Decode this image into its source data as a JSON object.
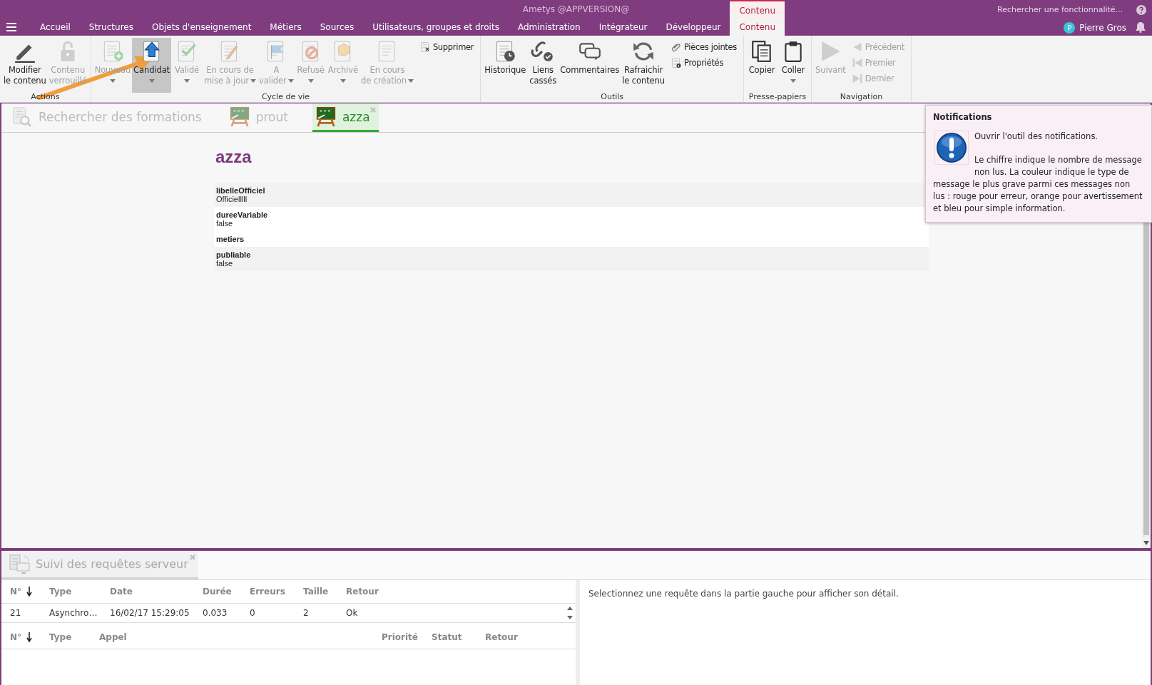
{
  "window": {
    "title": "Ametys @APPVERSION@"
  },
  "menu": {
    "contextual_group": "Contenu",
    "tabs": [
      {
        "label": "Accueil",
        "selected": false,
        "kind": "normal"
      },
      {
        "label": "Structures",
        "selected": false,
        "kind": "normal"
      },
      {
        "label": "Objets d'enseignement",
        "selected": false,
        "kind": "normal"
      },
      {
        "label": "Métiers",
        "selected": false,
        "kind": "normal"
      },
      {
        "label": "Sources",
        "selected": false,
        "kind": "normal"
      },
      {
        "label": "Utilisateurs, groupes et droits",
        "selected": false,
        "kind": "normal"
      },
      {
        "label": "Administration",
        "selected": false,
        "kind": "normal"
      },
      {
        "label": "Intégrateur",
        "selected": false,
        "kind": "normal"
      },
      {
        "label": "Développeur",
        "selected": false,
        "kind": "normal"
      },
      {
        "label": "Contenu",
        "selected": true,
        "kind": "contextual"
      }
    ]
  },
  "search": {
    "placeholder": "Rechercher une fonctionnalité..."
  },
  "user": {
    "initial": "P",
    "name": "Pierre Gros"
  },
  "ribbon": {
    "annotation": {
      "kind": "arrow"
    },
    "groups": [
      {
        "title": "Actions",
        "large": [
          {
            "label": "Modifier\nle contenu",
            "disabled": false,
            "selected": false
          },
          {
            "label": "Contenu\nverrouillé",
            "disabled": true,
            "selected": false
          }
        ]
      },
      {
        "title": "Cycle de vie",
        "large": [
          {
            "label": "Nouveau",
            "disabled": true,
            "selected": false,
            "menu": true,
            "caret_inline": false
          },
          {
            "label": "Candidat",
            "disabled": false,
            "selected": true,
            "menu": true,
            "caret_inline": false
          },
          {
            "label": "Validé",
            "disabled": true,
            "selected": false,
            "menu": true,
            "caret_inline": false
          },
          {
            "label": "En cours de\nmise à jour",
            "disabled": true,
            "selected": false,
            "menu": true,
            "caret_inline": true
          },
          {
            "label": "A\nvalider",
            "disabled": true,
            "selected": false,
            "menu": true,
            "caret_inline": true
          },
          {
            "label": "Refusé",
            "disabled": true,
            "selected": false,
            "menu": true,
            "caret_inline": false
          },
          {
            "label": "Archivé",
            "disabled": true,
            "selected": false,
            "menu": true,
            "caret_inline": false
          },
          {
            "label": "En cours\nde création",
            "disabled": true,
            "selected": false,
            "menu": true,
            "caret_inline": true
          }
        ],
        "small": [
          {
            "label": "Supprimer",
            "disabled": false
          }
        ]
      },
      {
        "title": "Outils",
        "large": [
          {
            "label": "Historique",
            "disabled": false,
            "selected": false
          },
          {
            "label": "Liens\ncassés",
            "disabled": false,
            "selected": false
          },
          {
            "label": "Commentaires",
            "disabled": false,
            "selected": false
          },
          {
            "label": "Rafraichir\nle contenu",
            "disabled": false,
            "selected": false
          }
        ],
        "small": [
          {
            "label": "Pièces jointes",
            "disabled": false
          },
          {
            "label": "Propriétés",
            "disabled": false
          }
        ]
      },
      {
        "title": "Presse-papiers",
        "large": [
          {
            "label": "Copier",
            "disabled": false,
            "selected": false
          },
          {
            "label": "Coller",
            "disabled": false,
            "selected": false,
            "menu": true,
            "caret_inline": false
          }
        ]
      },
      {
        "title": "Navigation",
        "large": [
          {
            "label": "Suivant",
            "disabled": true,
            "selected": false
          }
        ],
        "small": [
          {
            "label": "Précédent",
            "disabled": true
          },
          {
            "label": "Premier",
            "disabled": true
          },
          {
            "label": "Dernier",
            "disabled": true
          }
        ]
      }
    ]
  },
  "doc_tabs": [
    {
      "label": "Rechercher des formations",
      "kind": "search",
      "selected": false,
      "closable": false
    },
    {
      "label": "prout",
      "kind": "content",
      "selected": false,
      "closable": false
    },
    {
      "label": "azza",
      "kind": "content",
      "selected": true,
      "closable": true
    }
  ],
  "content": {
    "title": "azza",
    "fields": [
      {
        "name": "libelleOfficiel",
        "value": "Officielllll"
      },
      {
        "name": "dureeVariable",
        "value": "false"
      },
      {
        "name": "metiers"
      },
      {
        "name": "publiable",
        "value": "false"
      }
    ]
  },
  "tooltip": {
    "title": "Notifications",
    "paragraphs": [
      "Ouvrir l'outil des notifications.",
      "Le chiffre indique le nombre de message non lus. La couleur indique le type de message le plus grave parmi ces messages non lus : rouge pour erreur, orange pour avertissement et bleu pour simple information."
    ]
  },
  "bottom_panel": {
    "tab": {
      "label": "Suivi des requêtes serveur",
      "selected": true,
      "closable": true
    },
    "requests": {
      "columns": [
        "N°",
        "Type",
        "Date",
        "Durée",
        "Erreurs",
        "Taille",
        "Retour"
      ],
      "rows": [
        [
          "21",
          "Asynchro…",
          "16/02/17 15:29:05",
          "0.033",
          "0",
          "2",
          "Ok"
        ]
      ]
    },
    "calls": {
      "columns": [
        "N°",
        "Type",
        "Appel",
        "Priorité",
        "Statut",
        "Retour"
      ]
    },
    "detail": "Selectionnez une requête dans la partie gauche pour afficher son détail."
  }
}
